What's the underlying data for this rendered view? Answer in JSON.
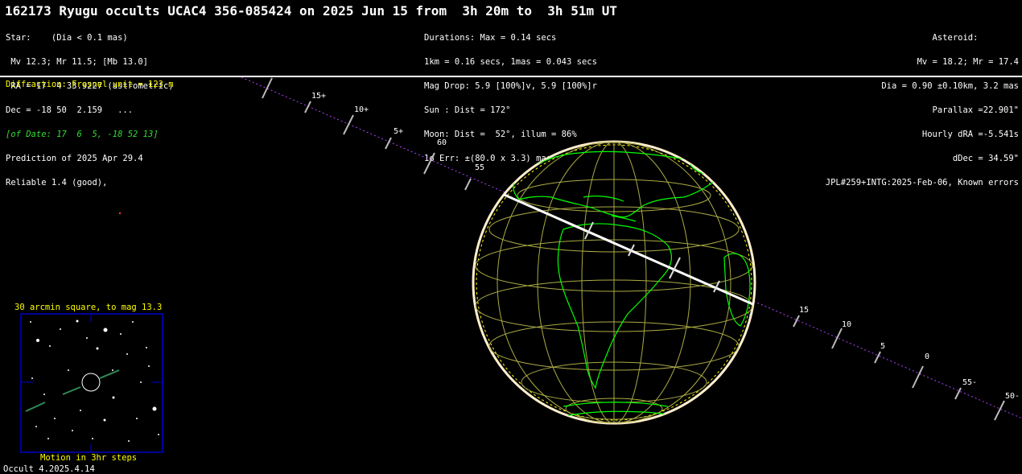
{
  "title": "162173 Ryugu occults UCAC4 356-085424 on 2025 Jun 15 from  3h 20m to  3h 51m UT",
  "star_block": [
    "Star:    (Dia < 0.1 mas)",
    " Mv 12.3; Mr 11.5; [Mb 13.0]",
    " RA = 17  4 33.9227 (astrometric)",
    "Dec = -18 50  2.159   ...",
    "[of Date: 17  6  5, -18 52 13]",
    "Prediction of 2025 Apr 29.4",
    "Reliable 1.4 (good),"
  ],
  "middle_block": [
    "Durations: Max = 0.14 secs",
    "1km = 0.16 secs, 1mas = 0.043 secs",
    "Mag Drop: 5.9 [100%]v, 5.9 [100%]r",
    "Sun : Dist = 172°",
    "Moon: Dist =  52°, illum = 86%",
    "1σ Err: ±(80.0 x 3.3) mas in PA 87°"
  ],
  "asteroid_block": [
    "Asteroid:        ",
    "Mv = 18.2; Mr = 17.4",
    "Dia = 0.90 ±0.10km, 3.2 mas",
    "Parallax =22.901\"",
    "Hourly dRA =-5.541s",
    "dDec = 34.59\"",
    "JPL#259+INTG:2025-Feb-06, Known errors"
  ],
  "diffraction": "Diffraction: Fresnel unit = 123 m",
  "track_labels_left": [
    "15+",
    "10+",
    "5+",
    "60",
    "55"
  ],
  "track_labels_right": [
    "15",
    "10",
    "5",
    "0",
    "55-",
    "50-"
  ],
  "finder": {
    "title": "30 arcmin square, to mag 13.3",
    "caption": "Motion in 3hr steps"
  },
  "footer": "Occult 4.2025.4.14",
  "colors": {
    "background": "#000000",
    "coastline": "#00ff00",
    "graticule": "#aaaa44",
    "track": "#aa44ff",
    "path": "#ffffff",
    "highlight": "#ffff00",
    "finder_border": "#0000cc"
  }
}
